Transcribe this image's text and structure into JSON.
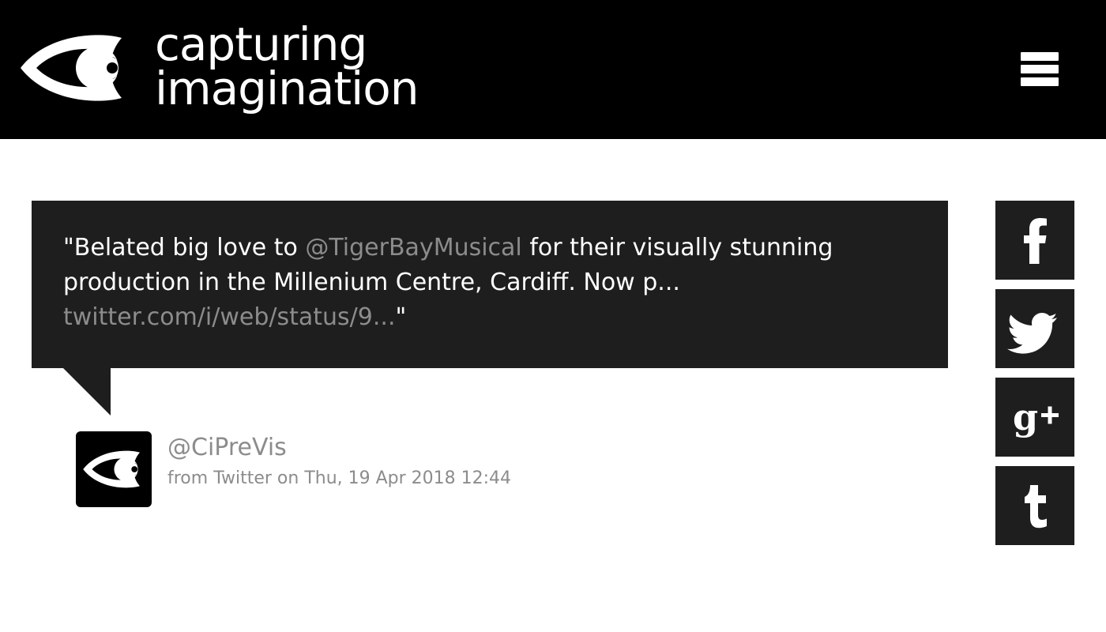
{
  "header": {
    "brand_line1": "capturing",
    "brand_line2": "imagination",
    "logo_icon": "eye-logo-icon",
    "menu_icon": "hamburger-menu-icon"
  },
  "tweet": {
    "text_before": "\"Belated big love to ",
    "mention": "@TigerBayMusical",
    "text_middle": " for their visually stunning production in the Millenium Centre, Cardiff. Now p... ",
    "link": "twitter.com/i/web/status/9...",
    "text_after": "\"",
    "handle": "@CiPreVis",
    "meta": "from Twitter on Thu, 19 Apr 2018 12:44"
  },
  "share": [
    {
      "icon": "facebook-icon",
      "glyph": "f"
    },
    {
      "icon": "twitter-icon"
    },
    {
      "icon": "google-plus-icon",
      "glyph": "g+"
    },
    {
      "icon": "tumblr-icon",
      "glyph": "t"
    }
  ],
  "colors": {
    "header_bg": "#000000",
    "bubble_bg": "#1e1e1e",
    "muted_text": "#8c8c8c",
    "text_light": "#ffffff"
  }
}
